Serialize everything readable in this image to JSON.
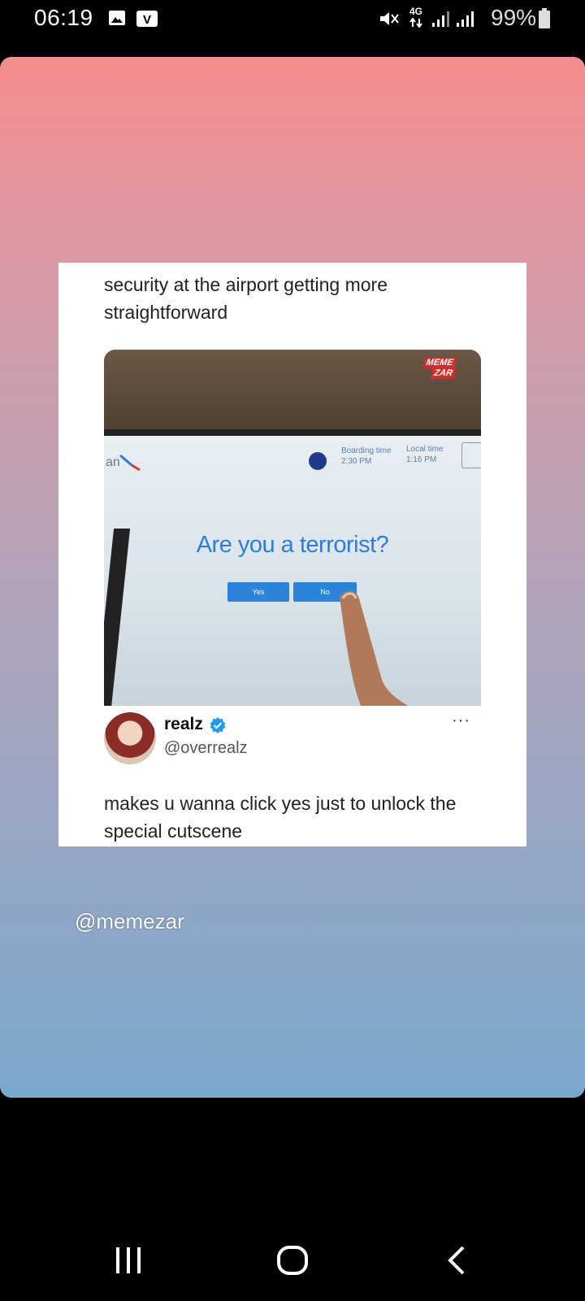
{
  "status_bar": {
    "time": "06:19",
    "network": "4G",
    "battery": "99%"
  },
  "post": {
    "caption": "security at the airport getting more straightforward",
    "photo": {
      "watermark_line1": "MEME",
      "watermark_line2": "ZAR",
      "airline_text": "an",
      "boarding_label": "Boarding time",
      "boarding_value": "2:30 PM",
      "local_label": "Local time",
      "local_value": "1:16 PM",
      "question": "Are you a terrorist?",
      "yes_label": "Yes",
      "no_label": "No"
    },
    "author": {
      "name": "realz",
      "handle": "@overrealz",
      "verified": true
    },
    "more_label": "···",
    "reply": "makes u wanna click yes just to unlock the special cutscene"
  },
  "credit": "@memezar",
  "colors": {
    "gradient_top": "#f58d8f",
    "gradient_bottom": "#7aa8cd",
    "kiosk_button": "#2b84d9",
    "verified_badge": "#1d9bf0"
  },
  "nav": {
    "icons": [
      "recent-apps-icon",
      "home-icon",
      "back-icon"
    ]
  }
}
